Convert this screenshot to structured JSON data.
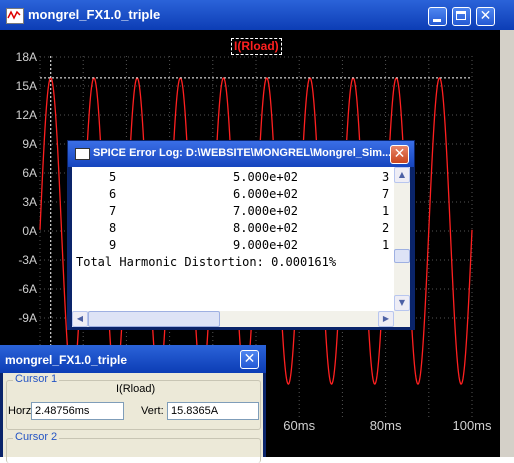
{
  "main_window": {
    "title": "mongrel_FX1.0_triple",
    "trace_label": "I(Rload)",
    "trace_color": "#ff2020"
  },
  "chart_data": {
    "type": "line",
    "title": "I(Rload)",
    "xlabel": "",
    "ylabel": "",
    "y_ticks": [
      "18A",
      "15A",
      "12A",
      "9A",
      "6A",
      "3A",
      "0A",
      "-3A",
      "-6A",
      "-9A"
    ],
    "x_ticks_visible": [
      "60ms",
      "80ms",
      "100ms"
    ],
    "ylim": [
      -18,
      18
    ],
    "xlim": [
      0,
      100
    ],
    "series": [
      {
        "waveform": "sine",
        "amplitude_A": 15.84,
        "frequency_hz": 100,
        "color": "#ff2020"
      }
    ],
    "cursor_level_A": 15.8365,
    "cursor_time_ms": 2.48756,
    "grid": true
  },
  "error_log": {
    "title": "SPICE Error Log: D:\\WEBSITE\\MONGREL\\Mongrel_Sim...",
    "rows": [
      {
        "n": "5",
        "freq": "5.000e+02",
        "tail": "3"
      },
      {
        "n": "6",
        "freq": "6.000e+02",
        "tail": "7"
      },
      {
        "n": "7",
        "freq": "7.000e+02",
        "tail": "1"
      },
      {
        "n": "8",
        "freq": "8.000e+02",
        "tail": "2"
      },
      {
        "n": "9",
        "freq": "9.000e+02",
        "tail": "1"
      }
    ],
    "thd": "Total Harmonic Distortion: 0.000161%"
  },
  "cursor_window": {
    "title": "mongrel_FX1.0_triple",
    "cursor1_legend": "Cursor 1",
    "trace": "I(Rload)",
    "horz_label": "Horz:",
    "horz_value": "2.48756ms",
    "vert_label": "Vert:",
    "vert_value": "15.8365A",
    "cursor2_legend": "Cursor 2"
  },
  "icons": [
    "waveform-app-icon",
    "minimize-icon",
    "maximize-icon",
    "close-icon",
    "document-icon",
    "scroll-up-icon",
    "scroll-down-icon",
    "scroll-left-icon",
    "scroll-right-icon"
  ]
}
